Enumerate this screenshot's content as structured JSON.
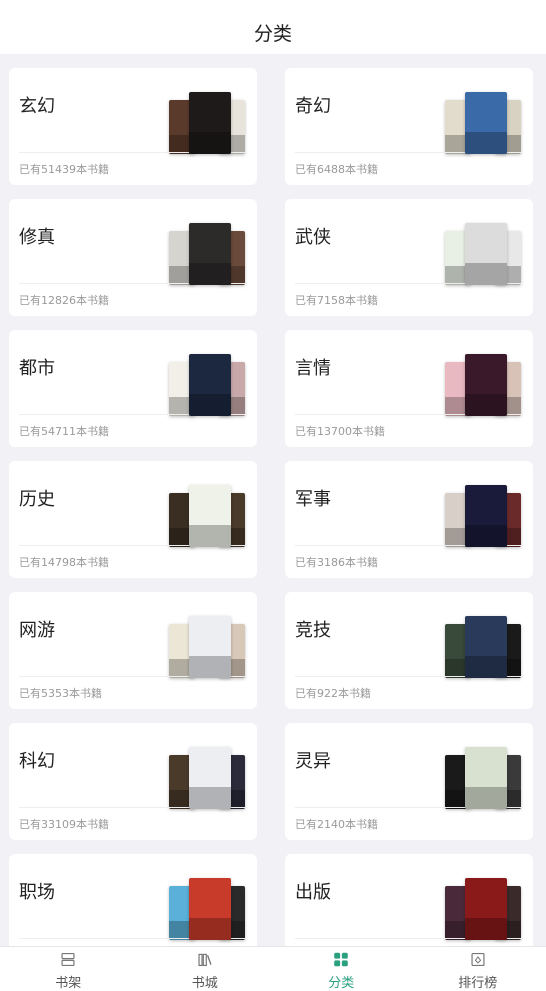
{
  "header": {
    "title": "分类"
  },
  "categories": [
    {
      "name": "玄幻",
      "count": "已有51439本书籍",
      "colors": [
        "#5a3a2a",
        "#1e1a1a",
        "#e8e4dc"
      ]
    },
    {
      "name": "奇幻",
      "count": "已有6488本书籍",
      "colors": [
        "#e2dccd",
        "#3b6aa8",
        "#d8d2c2"
      ]
    },
    {
      "name": "修真",
      "count": "已有12826本书籍",
      "colors": [
        "#d6d4cf",
        "#2d2a2a",
        "#6a4a3a"
      ]
    },
    {
      "name": "武侠",
      "count": "已有7158本书籍",
      "colors": [
        "#e8efe4",
        "#dcdcdc",
        "#e8e8e8"
      ]
    },
    {
      "name": "都市",
      "count": "已有54711本书籍",
      "colors": [
        "#f2efe9",
        "#1c2740",
        "#c8a8a8"
      ]
    },
    {
      "name": "言情",
      "count": "已有13700本书籍",
      "colors": [
        "#e9b9c2",
        "#3a1a2a",
        "#d8c2b8"
      ]
    },
    {
      "name": "历史",
      "count": "已有14798本书籍",
      "colors": [
        "#3a2e22",
        "#eef2e8",
        "#4a3a2a"
      ]
    },
    {
      "name": "军事",
      "count": "已有3186本书籍",
      "colors": [
        "#d8cfc8",
        "#1a1a3a",
        "#6a2a2a"
      ]
    },
    {
      "name": "网游",
      "count": "已有5353本书籍",
      "colors": [
        "#ece6d6",
        "#eceef2",
        "#d8c8b8"
      ]
    },
    {
      "name": "竞技",
      "count": "已有922本书籍",
      "colors": [
        "#3a4a3a",
        "#2a3a5a",
        "#1a1a1a"
      ]
    },
    {
      "name": "科幻",
      "count": "已有33109本书籍",
      "colors": [
        "#4a3a2a",
        "#eceef2",
        "#2a2a3a"
      ]
    },
    {
      "name": "灵异",
      "count": "已有2140本书籍",
      "colors": [
        "#1a1a1a",
        "#d8e0d0",
        "#3a3a3a"
      ]
    },
    {
      "name": "职场",
      "count": "",
      "colors": [
        "#5ab0d8",
        "#c83a2a",
        "#2a2a2a"
      ]
    },
    {
      "name": "出版",
      "count": "",
      "colors": [
        "#4a2a3a",
        "#8a1a1a",
        "#3a2a2a"
      ]
    }
  ],
  "tabbar": {
    "items": [
      {
        "label": "书架",
        "icon": "bookshelf-icon"
      },
      {
        "label": "书城",
        "icon": "bookstore-icon"
      },
      {
        "label": "分类",
        "icon": "category-icon"
      },
      {
        "label": "排行榜",
        "icon": "ranking-icon"
      }
    ],
    "active_index": 2,
    "active_color": "#2aa07f"
  }
}
